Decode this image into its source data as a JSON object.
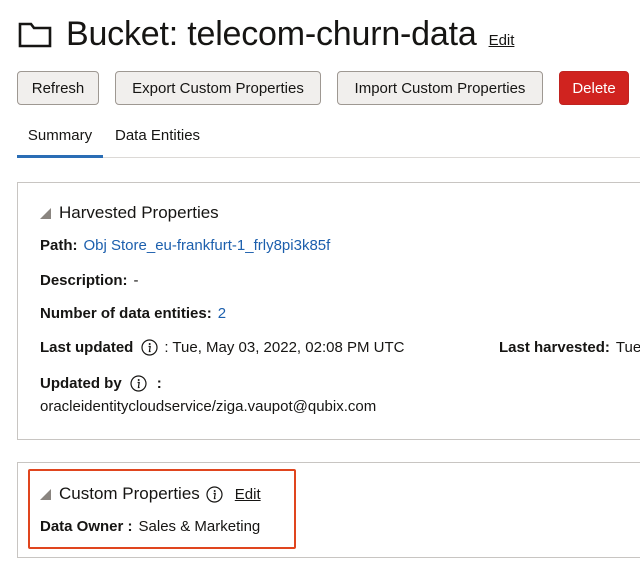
{
  "header": {
    "title": "Bucket: telecom-churn-data",
    "edit_label": "Edit"
  },
  "toolbar": {
    "refresh_label": "Refresh",
    "export_label": "Export Custom Properties",
    "import_label": "Import Custom Properties",
    "delete_label": "Delete"
  },
  "tabs": [
    {
      "label": "Summary",
      "active": true
    },
    {
      "label": "Data Entities",
      "active": false
    }
  ],
  "harvested": {
    "title": "Harvested Properties",
    "path_label": "Path:",
    "path_value": "Obj Store_eu-frankfurt-1_frly8pi3k85f",
    "description_label": "Description:",
    "description_value": "-",
    "entities_label": "Number of data entities:",
    "entities_value": "2",
    "last_updated_label": "Last updated",
    "last_updated_value": ": Tue, May 03, 2022, 02:08 PM UTC",
    "last_harvested_label": "Last harvested:",
    "last_harvested_value": "Tue,",
    "updated_by_label": "Updated by",
    "updated_by_sep": ":",
    "updated_by_value": "oracleidentitycloudservice/ziga.vaupot@qubix.com"
  },
  "custom": {
    "title": "Custom Properties",
    "edit_label": "Edit",
    "owner_label": "Data Owner :",
    "owner_value": "Sales & Marketing"
  },
  "colors": {
    "link": "#1c5fad",
    "delete": "#d0231f",
    "highlight": "#e0451e",
    "active_tab": "#2a6db5"
  }
}
